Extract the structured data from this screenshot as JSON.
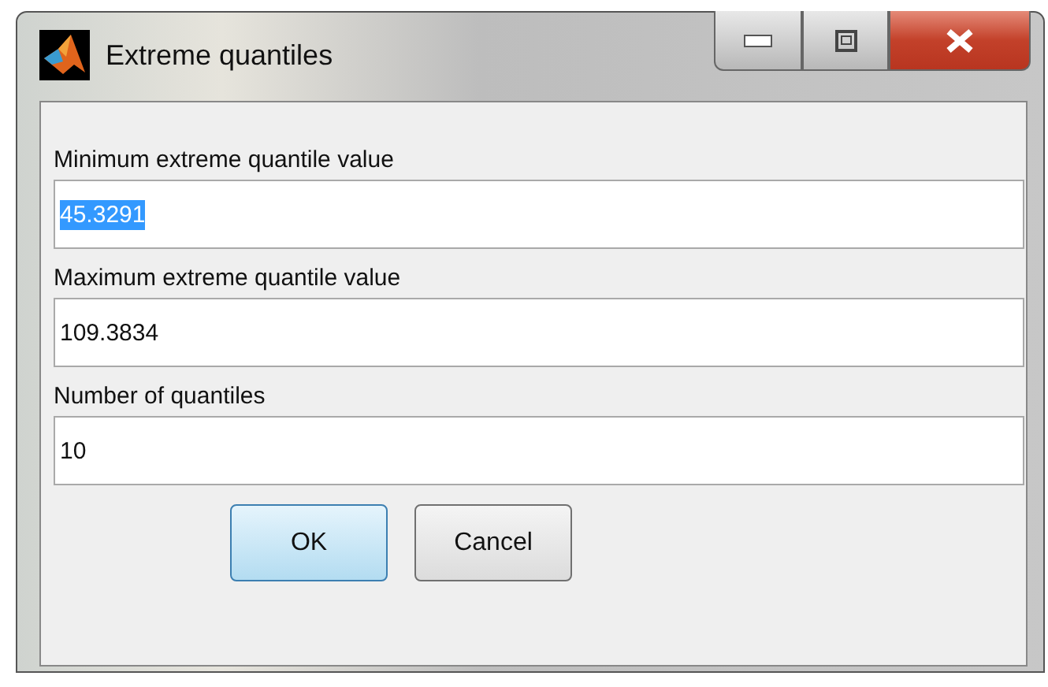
{
  "window": {
    "title": "Extreme quantiles"
  },
  "fields": [
    {
      "label": "Minimum extreme quantile value",
      "value": "45.3291",
      "text_selected": true
    },
    {
      "label": "Maximum extreme quantile value",
      "value": "109.3834",
      "text_selected": false
    },
    {
      "label": "Number of quantiles",
      "value": "10",
      "text_selected": false
    }
  ],
  "buttons": [
    {
      "label": "OK",
      "default": true
    },
    {
      "label": "Cancel",
      "default": false
    }
  ]
}
